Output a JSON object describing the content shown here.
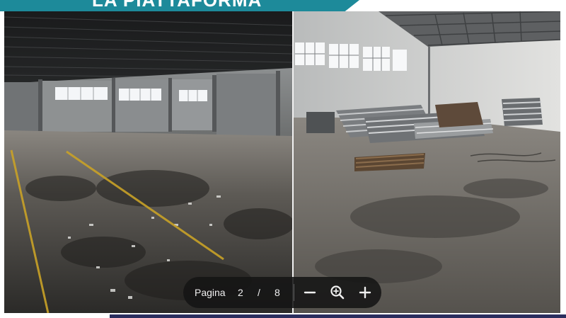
{
  "slide": {
    "title": "LA PIATTAFORMA"
  },
  "viewer": {
    "page_label": "Pagina",
    "current_page": "2",
    "separator": "/",
    "total_pages": "8",
    "icons": {
      "zoom_out": "minus-icon",
      "zoom_reset": "magnifier-plus-icon",
      "zoom_in": "plus-icon"
    }
  },
  "colors": {
    "banner": "#1d8a9a",
    "footer_bar": "#2b2e5e",
    "toolbar_bg": "#141414",
    "floor_line": "#c9a227"
  }
}
